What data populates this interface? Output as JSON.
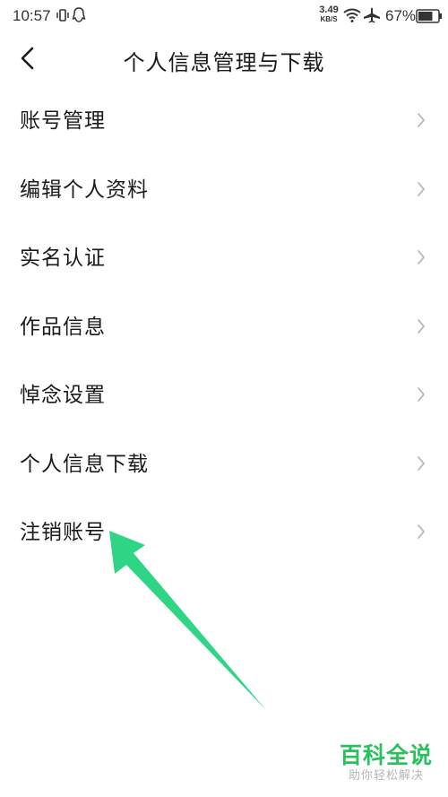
{
  "status_bar": {
    "time": "10:57",
    "net_speed_value": "3.49",
    "net_speed_unit": "KB/S",
    "battery_percent": "67%",
    "icons": [
      "vibrate-icon",
      "qq-icon",
      "wifi-icon",
      "airplane-icon",
      "battery-icon"
    ]
  },
  "header": {
    "title": "个人信息管理与下载",
    "back_icon": "chevron-left-icon"
  },
  "menu": {
    "items": [
      {
        "label": "账号管理"
      },
      {
        "label": "编辑个人资料"
      },
      {
        "label": "实名认证"
      },
      {
        "label": "作品信息"
      },
      {
        "label": "悼念设置"
      },
      {
        "label": "个人信息下载"
      },
      {
        "label": "注销账号"
      }
    ],
    "chevron_icon": "chevron-right-icon"
  },
  "annotation": {
    "arrow_color": "#2ed584",
    "points_to": "注销账号"
  },
  "watermark": {
    "title": "百科全说",
    "subtitle": "助你轻松解决",
    "color": "#27c25e"
  }
}
